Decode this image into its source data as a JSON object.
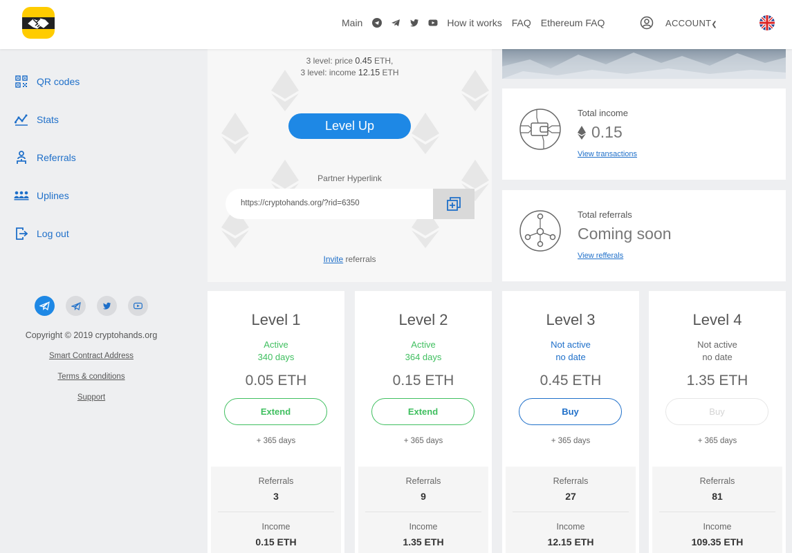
{
  "header": {
    "nav": [
      "Main",
      "How it works",
      "FAQ",
      "Ethereum FAQ"
    ],
    "account_label": "ACCOUNT"
  },
  "sidebar": {
    "items": [
      {
        "label": "QR codes",
        "icon": "qr-code-icon"
      },
      {
        "label": "Stats",
        "icon": "stats-icon"
      },
      {
        "label": "Referrals",
        "icon": "referrals-icon"
      },
      {
        "label": "Uplines",
        "icon": "uplines-icon"
      },
      {
        "label": "Log out",
        "icon": "logout-icon"
      }
    ],
    "copyright": "Copyright © 2019 cryptohands.org",
    "links": [
      "Smart Contract Address",
      "Terms & conditions",
      "Support"
    ]
  },
  "levelup": {
    "line1_prefix": "3 level: price ",
    "line1_value": "0.45",
    "line1_suffix": " ETH,",
    "line2_prefix": "3 level: income ",
    "line2_value": "12.15",
    "line2_suffix": " ETH",
    "button_label": "Level Up",
    "partner_label": "Partner Hyperlink",
    "partner_link": "https://cryptohands.org/?rid=6350",
    "invite_link": "Invite",
    "invite_suffix": " referrals"
  },
  "stats": {
    "income": {
      "label": "Total income",
      "value": "0.15",
      "link": "View transactions"
    },
    "referrals": {
      "label": "Total referrals",
      "value": "Coming soon",
      "link": "View refferals"
    }
  },
  "levels": [
    {
      "title": "Level 1",
      "status": "Active",
      "days": "340 days",
      "price": "0.05 ETH",
      "button": "Extend",
      "plus": "+ 365 days",
      "ref_label": "Referrals",
      "referrals": "3",
      "inc_label": "Income",
      "income": "0.15 ETH"
    },
    {
      "title": "Level 2",
      "status": "Active",
      "days": "364 days",
      "price": "0.15 ETH",
      "button": "Extend",
      "plus": "+ 365 days",
      "ref_label": "Referrals",
      "referrals": "9",
      "inc_label": "Income",
      "income": "1.35 ETH"
    },
    {
      "title": "Level 3",
      "status": "Not active",
      "days": "no date",
      "price": "0.45 ETH",
      "button": "Buy",
      "plus": "+ 365 days",
      "ref_label": "Referrals",
      "referrals": "27",
      "inc_label": "Income",
      "income": "12.15 ETH"
    },
    {
      "title": "Level 4",
      "status": "Not active",
      "days": "no date",
      "price": "1.35 ETH",
      "button": "Buy",
      "plus": "+ 365 days",
      "ref_label": "Referrals",
      "referrals": "81",
      "inc_label": "Income",
      "income": "109.35 ETH"
    }
  ],
  "colors": {
    "accent": "#1e88e5",
    "active": "#3fbf5f",
    "logo": "#ffcc00"
  }
}
